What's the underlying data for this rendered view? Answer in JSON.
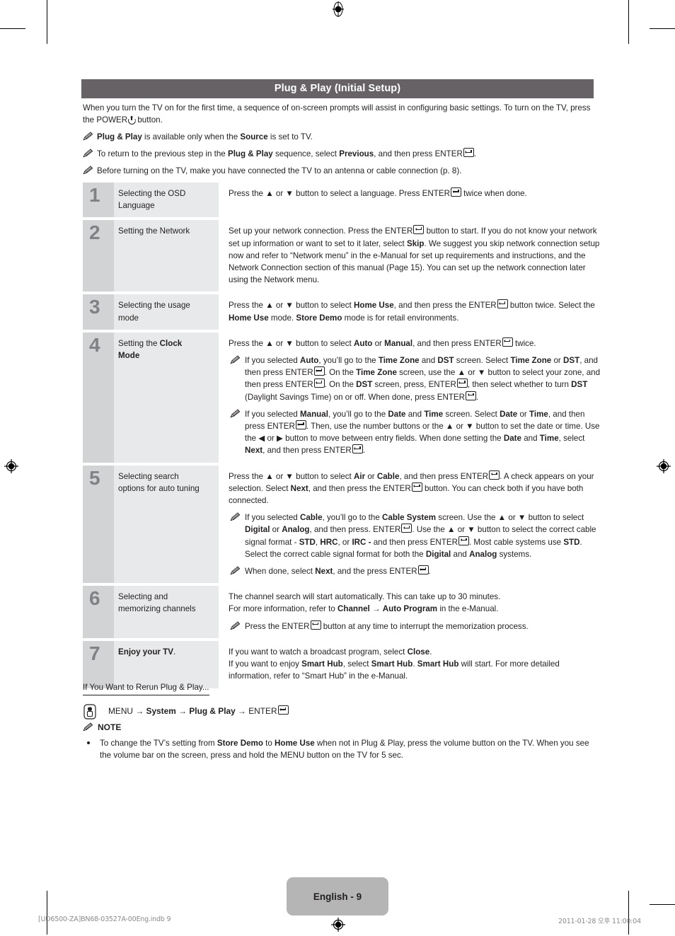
{
  "header": {
    "title": "Plug & Play (Initial Setup)",
    "bar_color": "#666265"
  },
  "intro": {
    "paragraph": "When you turn the TV on for the first time, a sequence of on-screen prompts will assist in configuring basic settings. To turn on the TV, press the POWER ⏻ button.",
    "notes": [
      "Plug & Play is available only when the Source is set to TV.",
      "To return to the previous step in the Plug & Play sequence, select Previous, and then press ENTER↵.",
      "Before turning on the TV, make you have connected the TV to an antenna or cable connection (p. 8)."
    ]
  },
  "power_illustration": {
    "label": "POWER",
    "icon": "power-button-with-hand-illustration"
  },
  "steps": [
    {
      "number": "1",
      "title": "Selecting the OSD Language",
      "description": "Press the ▲ or ▼ button to select a language. Press ENTER↵ twice when done.",
      "subnotes": []
    },
    {
      "number": "2",
      "title": "Setting the Network",
      "description": "Set up your network connection. Press the ENTER↵ button to start. If you do not know your network set up information or want to set to it later, select Skip. We suggest you skip network connection setup now and refer to “Network menu” in the e-Manual for set up requirements and instructions, and the Network Connection section of this manual (Page 15). You can set up the network connection later using the Network menu.",
      "subnotes": []
    },
    {
      "number": "3",
      "title": "Selecting the usage mode",
      "description": "Press the ▲ or ▼ button to select Home Use, and then press the ENTER↵ button twice. Select the Home Use mode. Store Demo mode is for retail environments.",
      "subnotes": []
    },
    {
      "number": "4",
      "title": "Setting the Clock Mode",
      "description": "Press the ▲ or ▼ button to select Auto or Manual, and then press ENTER↵ twice.",
      "subnotes": [
        "If you selected Auto, you’ll go to the Time Zone and DST screen. Select Time Zone or DST, and then press ENTER↵. On the Time Zone screen, use the ▲ or ▼ button to select your zone, and then press ENTER↵. On the DST screen, press, ENTER↵, then select whether to turn DST (Daylight Savings Time) on or off. When done, press ENTER↵.",
        "If you selected Manual, you’ll go to the Date and Time screen. Select Date or Time, and then press ENTER↵. Then, use the number buttons or the ▲ or ▼ button to set the date or time. Use the ◀ or ▶ button to move between entry fields. When done setting the Date and Time, select Next, and then press ENTER↵."
      ]
    },
    {
      "number": "5",
      "title": "Selecting search options for auto tuning",
      "description": "Press the ▲ or ▼ button to select Air or Cable, and then press ENTER↵. A check appears on your selection. Select Next, and then press the ENTER↵ button. You can check both if you have both connected.",
      "subnotes": [
        "If you selected Cable, you’ll go to the Cable System screen. Use the ▲ or ▼ button to select Digital or Analog, and then press. ENTER↵. Use the ▲ or ▼ button to select the correct cable signal format - STD, HRC, or IRC - and then press ENTER↵. Most cable systems use STD. Select the correct cable signal format for both the Digital and Analog systems.",
        "When done, select Next, and the press ENTER↵."
      ]
    },
    {
      "number": "6",
      "title": "Selecting and memorizing channels",
      "description": "The channel search will start automatically. This can take up to 30 minutes. For more information, refer to Channel → Auto Program in the e-Manual.",
      "subnotes": [
        "Press the ENTER↵ button at any time to interrupt the memorization process."
      ]
    },
    {
      "number": "7",
      "title": "Enjoy your TV.",
      "description": "If you want to watch a broadcast program, select Close. If you want to enjoy Smart Hub, select Smart Hub. Smart Hub will start. For more detailed information, refer to “Smart Hub” in the e-Manual.",
      "subnotes": []
    }
  ],
  "rerun": {
    "heading": "If You Want to Rerun Plug & Play...",
    "path": "MENU → System → Plug & Play → ENTER↵",
    "icon": "remote-control-icon"
  },
  "note": {
    "heading": "NOTE",
    "items": [
      "To change the TV’s setting from Store Demo to Home Use when not in Plug & Play, press the volume button on the TV. When you see the volume bar on the screen, press and hold the MENU button on the TV for 5 sec."
    ]
  },
  "page_badge": {
    "label": "English - 9",
    "color": "#b5b5b5"
  },
  "footer": {
    "left": "[UD6500-ZA]BN68-03527A-00Eng.indb   9",
    "right": "2011-01-28   오후 11:00:04"
  }
}
